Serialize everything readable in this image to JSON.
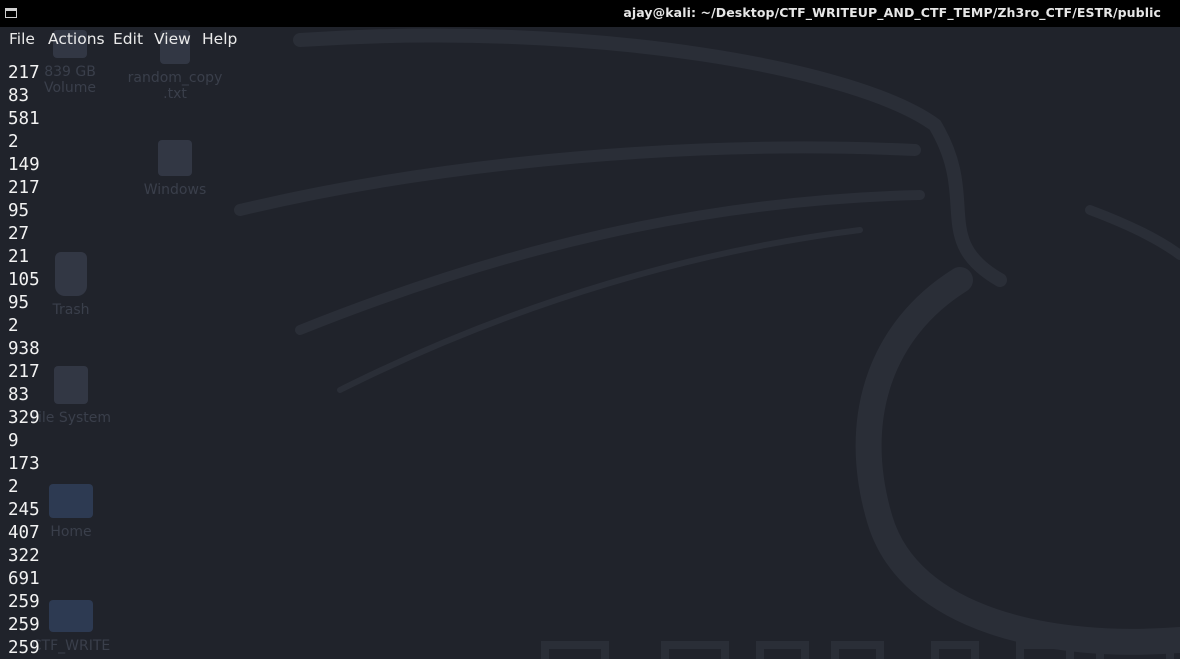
{
  "window": {
    "title": "ajay@kali: ~/Desktop/CTF_WRITEUP_AND_CTF_TEMP/Zh3ro_CTF/ESTR/public",
    "icon": "terminal-window-icon"
  },
  "menu": [
    {
      "label": "File"
    },
    {
      "label": "Actions"
    },
    {
      "label": "Edit"
    },
    {
      "label": "View"
    },
    {
      "label": "Help"
    }
  ],
  "desktop_icons": [
    {
      "label": "839 GB Volume",
      "icon": "drive-icon"
    },
    {
      "label": "random_copy .txt",
      "icon": "file-icon"
    },
    {
      "label": "Windows",
      "icon": "drive-icon"
    },
    {
      "label": "Trash",
      "icon": "trash-icon"
    },
    {
      "label": "File System",
      "icon": "drive-icon"
    },
    {
      "label": "Home",
      "icon": "home-folder-icon"
    },
    {
      "label": "CTF_WRITE",
      "icon": "folder-icon"
    }
  ],
  "terminal_lines": [
    "217",
    "83",
    "581",
    "2",
    "149",
    "217",
    "95",
    "27",
    "21",
    "105",
    "95",
    "2",
    "938",
    "217",
    "83",
    "329",
    "9",
    "173",
    "2",
    "245",
    "407",
    "322",
    "691",
    "259",
    "259",
    "259"
  ]
}
